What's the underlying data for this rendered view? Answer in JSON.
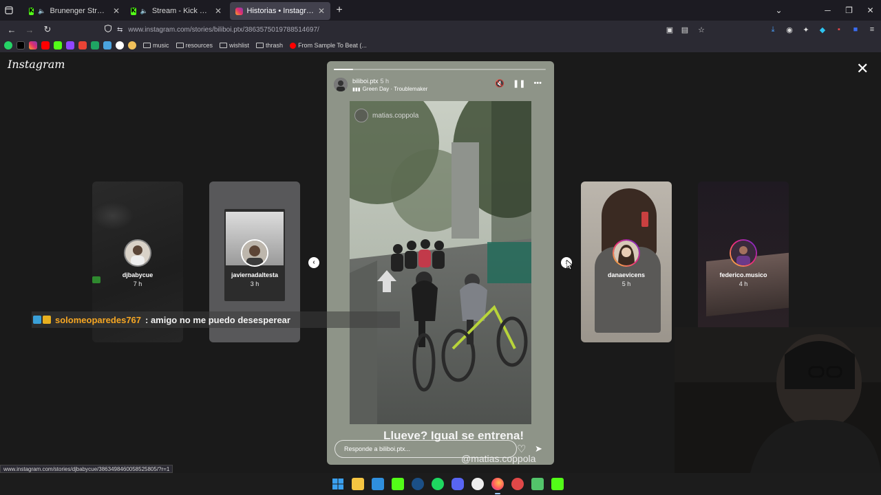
{
  "browser": {
    "tabs": [
      {
        "title": "Brunenger Stream - Watch",
        "favicon": "kick-icon",
        "muted": true,
        "active": false
      },
      {
        "title": "Stream - Kick Dashboard",
        "favicon": "kick-icon",
        "muted": true,
        "active": false
      },
      {
        "title": "Historias • Instagram",
        "favicon": "instagram-icon",
        "muted": false,
        "active": true
      }
    ],
    "url": "www.instagram.com/stories/biliboi.ptx/3863575019788514697/",
    "bookmarks": {
      "folders": [
        "music",
        "resources",
        "wishlist",
        "thrash"
      ],
      "last_item": "From Sample To Beat (..."
    },
    "status_url": "www.instagram.com/stories/djbabycue/3863498460058525805/?r=1"
  },
  "instagram": {
    "logo": "Instagram",
    "side_stories": [
      {
        "username": "djbabycue",
        "time": "7 h"
      },
      {
        "username": "javiernadaltesta",
        "time": "3 h"
      },
      {
        "username": "danaevicens",
        "time": "5 h"
      },
      {
        "username": "federico.musico",
        "time": "4 h"
      }
    ],
    "current_story": {
      "username": "biliboi.ptx",
      "time": "5 h",
      "music": "Green Day · Troublemaker",
      "progress": 0.09,
      "repost_handle": "matias.coppola",
      "caption": "Llueve? Igual se entrena!",
      "caption_handle": "@matias.coppola",
      "reply_placeholder": "Responde a biliboi.ptx..."
    }
  },
  "chat_overlay": {
    "username": "solomeoparedes767",
    "message": ": amigo no me puedo desesperear"
  },
  "colors": {
    "chat_username": "#f5a623",
    "kick_green": "#53fc18",
    "story_bg": "#8e9488"
  }
}
